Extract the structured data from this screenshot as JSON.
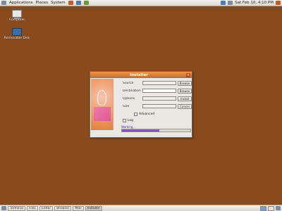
{
  "top_panel": {
    "menus": [
      "Applications",
      "Places",
      "System"
    ],
    "clock": "Sat Feb 10, 4:10 PM"
  },
  "desktop": {
    "icons": [
      {
        "label": "Computer",
        "icon": "computer-icon"
      },
      {
        "label": "Removable Disk",
        "icon": "drive-icon"
      }
    ]
  },
  "dialog": {
    "title": "Installer",
    "close_glyph": "×",
    "rows": [
      {
        "label": "Source",
        "value": "",
        "button": "Browse"
      },
      {
        "label": "Destination",
        "value": "",
        "button": "Browse"
      },
      {
        "label": "Options",
        "value": "",
        "button": "Install"
      },
      {
        "label": "Size",
        "value": "",
        "button": "Cancel"
      }
    ],
    "checkboxes": [
      {
        "label": "Advanced"
      },
      {
        "label": "Log"
      }
    ],
    "status_text": "Working...",
    "progress": 0.55
  },
  "bottom_panel": {
    "tasks": [
      "Terminal",
      "Files",
      "Editor",
      "Browser",
      "Mail",
      "Installer"
    ]
  },
  "colors": {
    "desktop_bg": "#8b4a1c",
    "title_accent": "#c96a22",
    "progress_fill": "#6d3dbb"
  }
}
